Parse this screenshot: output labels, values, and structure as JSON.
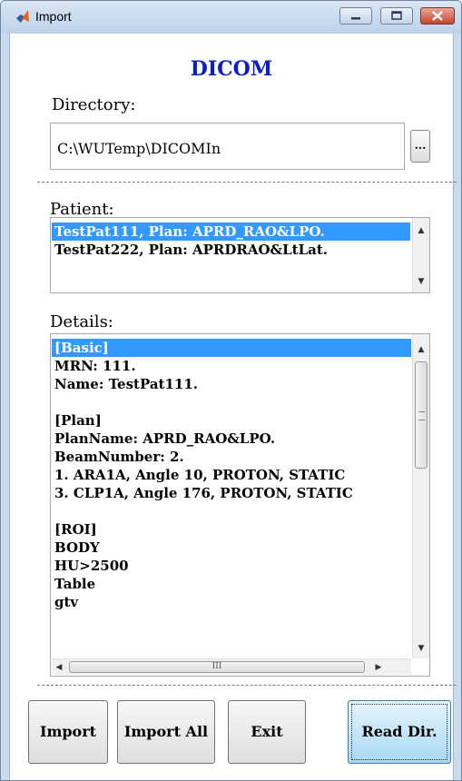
{
  "window": {
    "title": "Import",
    "controls": {
      "minimize": "minimize",
      "maximize": "maximize",
      "close": "close"
    }
  },
  "header": {
    "title": "DICOM"
  },
  "directory": {
    "label": "Directory:",
    "value": "C:\\WUTemp\\DICOMIn",
    "browse_label": "..."
  },
  "patient": {
    "label": "Patient:",
    "items": [
      {
        "text": "TestPat111, Plan: APRD_RAO&LPO.",
        "selected": true
      },
      {
        "text": "TestPat222, Plan: APRDRAO&LtLat.",
        "selected": false
      }
    ]
  },
  "details": {
    "label": "Details:",
    "lines": [
      "[Basic]",
      "MRN: 111.",
      "Name: TestPat111.",
      "",
      "[Plan]",
      "PlanName: APRD_RAO&LPO.",
      "BeamNumber: 2.",
      "1. ARA1A, Angle 10, PROTON, STATIC",
      "3. CLP1A, Angle 176, PROTON, STATIC",
      "",
      "[ROI]",
      "BODY",
      "HU>2500",
      "Table",
      "gtv"
    ],
    "selected_index": 0,
    "hscroll_grip": "III",
    "vscroll_grip": "≡"
  },
  "buttons": {
    "import": "Import",
    "import_all": "Import All",
    "exit": "Exit",
    "read_dir": "Read Dir."
  },
  "colors": {
    "title_accent": "#0a1fc8",
    "selection": "#3399ff",
    "focused_button": "#a8d8f5"
  }
}
